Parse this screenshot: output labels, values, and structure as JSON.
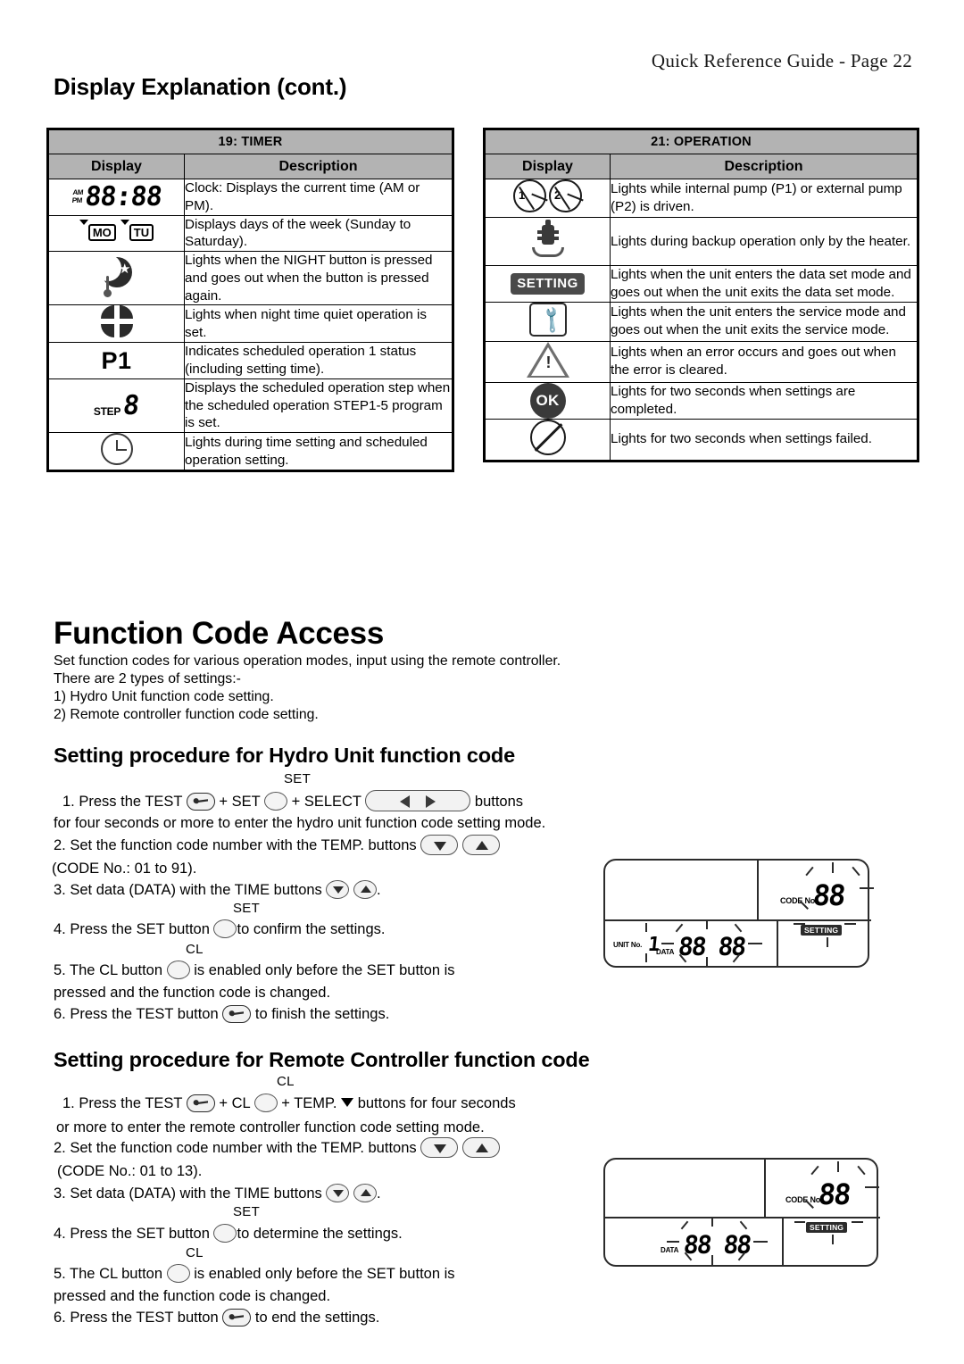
{
  "header": {
    "guide_title": "Quick Reference Guide  -  Page 22",
    "section_title": "Display Explanation (cont.)"
  },
  "tables": [
    {
      "id": "timer",
      "title": "19: TIMER",
      "columns": [
        "Display",
        "Description"
      ],
      "rows": [
        {
          "icon": "seven-segment-clock-am-pm",
          "icon_text": "88:88",
          "am": "AM",
          "pm": "PM",
          "description": "Clock: Displays the current time (AM or PM)."
        },
        {
          "icon": "day-of-week-indicator",
          "day1": "MO",
          "day2": "TU",
          "description": "Displays days of the week (Sunday to Saturday)."
        },
        {
          "icon": "night-moon-thermometer-icon",
          "description": "Lights when the NIGHT button is pressed and goes out when the button is pressed again."
        },
        {
          "icon": "quiet-operation-icon",
          "description": "Lights when night time quiet operation is set."
        },
        {
          "icon": "p1-text",
          "icon_text": "P1",
          "description": "Indicates scheduled operation 1 status (including setting time)."
        },
        {
          "icon": "step-digit-icon",
          "icon_text": "STEP",
          "description": "Displays the scheduled operation step when the scheduled operation STEP1-5 program is set."
        },
        {
          "icon": "clock-face-icon",
          "description": "Lights during time setting and scheduled operation setting."
        }
      ]
    },
    {
      "id": "operation",
      "title": "21: OPERATION",
      "columns": [
        "Display",
        "Description"
      ],
      "rows": [
        {
          "icon": "pump-1-2-icon",
          "pump1": "1",
          "pump2": "2",
          "description": "Lights while internal pump (P1) or external pump (P2) is driven."
        },
        {
          "icon": "backup-heater-icon",
          "description": "Lights during backup operation only by the heater."
        },
        {
          "icon": "setting-badge-icon",
          "icon_text": "SETTING",
          "description": "Lights when the unit enters the data set mode and goes out when the unit exits the data set mode."
        },
        {
          "icon": "service-wrench-icon",
          "description": "Lights when the unit enters the service mode and goes out when the unit exits the service mode."
        },
        {
          "icon": "warning-triangle-icon",
          "description": "Lights when an error occurs and goes out when the error is cleared."
        },
        {
          "icon": "ok-badge-icon",
          "icon_text": "OK",
          "description": "Lights for two seconds when settings are completed."
        },
        {
          "icon": "prohibited-circle-icon",
          "description": "Lights for two seconds when settings failed."
        }
      ]
    }
  ],
  "function_code_access": {
    "heading": "Function Code Access",
    "intro_line_1": "Set function codes for various operation modes, input using the remote controller.",
    "intro_line_2": "There are 2 types of settings:-",
    "intro_line_3": "1) Hydro Unit function code setting.",
    "intro_line_4": "2) Remote controller function code setting."
  },
  "hydro_unit": {
    "heading": "Setting procedure for Hydro Unit function code",
    "step1_a": "1. Press the TEST",
    "step1_b": "+ SET",
    "step1_c": "+ SELECT",
    "step1_d": "buttons",
    "step1_label_set": "SET",
    "step1_line2": "for four seconds or more to enter the hydro unit function code setting mode.",
    "step2_a": "2. Set the function code number with the TEMP. buttons",
    "step2_line2": "(CODE No.: 01 to 91).",
    "step3_a": "3. Set data (DATA) with the TIME buttons",
    "step3_end": ".",
    "step4_label_set": "SET",
    "step4_a": "4. Press the SET button",
    "step4_b": "to confirm the settings.",
    "step5_label_cl": "CL",
    "step5_a": "5. The CL button",
    "step5_b": "is enabled only before the SET button is",
    "step5_line2": "pressed and the function code is changed.",
    "step6_a": "6. Press the TEST button",
    "step6_b": "to finish the settings."
  },
  "remote_controller": {
    "heading": "Setting procedure for Remote Controller function code",
    "step1_label_cl": "CL",
    "step1_a": "1. Press the TEST",
    "step1_b": "+ CL",
    "step1_c": "+ TEMP.",
    "step1_d": "buttons for four seconds",
    "step1_line2": "or more to enter the remote controller function code setting mode.",
    "step2_a": "2. Set the function code number with the TEMP. buttons",
    "step2_line2": "(CODE No.: 01 to 13).",
    "step3_a": "3. Set data (DATA) with the TIME buttons",
    "step3_end": ".",
    "step4_label_set": "SET",
    "step4_a": "4. Press the SET button",
    "step4_b": "to determine the settings.",
    "step5_label_cl": "CL",
    "step5_a": "5. The CL button",
    "step5_b": "is enabled only before the SET button is",
    "step5_line2": "pressed and the function code is changed.",
    "step6_a": "6. Press the TEST button",
    "step6_b": "to end the settings."
  },
  "lcd_panel_1": {
    "code_label": "CODE No.",
    "code_digits": "88",
    "setting_badge": "SETTING",
    "unit_label": "UNIT No.",
    "unit_value": "1",
    "data_label": "DATA",
    "data_digits": "88 88"
  },
  "lcd_panel_2": {
    "code_label": "CODE No.",
    "code_digits": "88",
    "setting_badge": "SETTING",
    "data_label": "DATA",
    "data_digits": "88 88"
  },
  "colors": {
    "table_header_bg": "#b3b3b3",
    "border": "#000000",
    "icon_dark": "#2b2b2b",
    "badge_bg": "#4a4a4a"
  }
}
